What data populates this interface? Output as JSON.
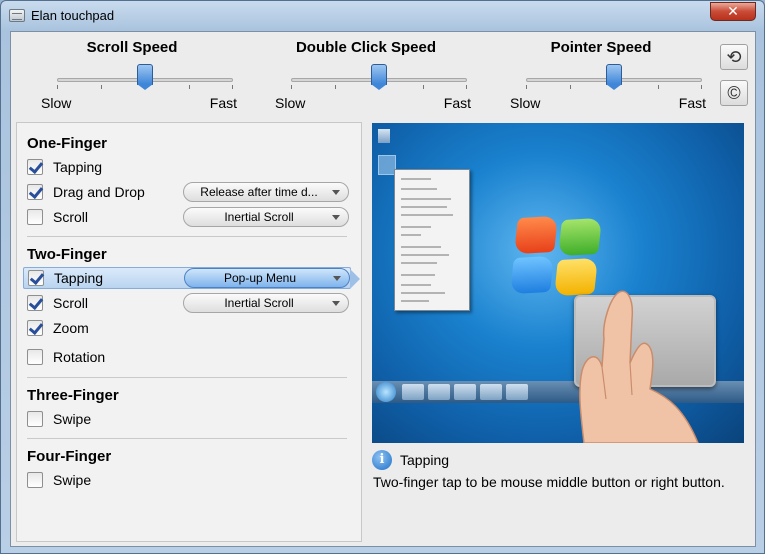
{
  "window": {
    "title": "Elan touchpad",
    "close_label": "✕"
  },
  "sliders": [
    {
      "title": "Scroll Speed",
      "min_label": "Slow",
      "max_label": "Fast",
      "value": 0.5
    },
    {
      "title": "Double Click Speed",
      "min_label": "Slow",
      "max_label": "Fast",
      "value": 0.5
    },
    {
      "title": "Pointer Speed",
      "min_label": "Slow",
      "max_label": "Fast",
      "value": 0.5
    }
  ],
  "side_buttons": {
    "reset_icon": "reset-icon",
    "about_icon": "copyright-icon",
    "reset_glyph": "⟲",
    "about_glyph": "©"
  },
  "groups": {
    "one_finger": {
      "title": "One-Finger",
      "tapping": {
        "label": "Tapping",
        "checked": true
      },
      "drag": {
        "label": "Drag and Drop",
        "checked": true,
        "option": "Release after time d..."
      },
      "scroll": {
        "label": "Scroll",
        "checked": false,
        "option": "Inertial Scroll"
      }
    },
    "two_finger": {
      "title": "Two-Finger",
      "tapping": {
        "label": "Tapping",
        "checked": true,
        "option": "Pop-up Menu"
      },
      "scroll": {
        "label": "Scroll",
        "checked": true,
        "option": "Inertial Scroll"
      },
      "zoom": {
        "label": "Zoom",
        "checked": true
      },
      "rotation": {
        "label": "Rotation",
        "checked": false
      }
    },
    "three_finger": {
      "title": "Three-Finger",
      "swipe": {
        "label": "Swipe",
        "checked": false
      }
    },
    "four_finger": {
      "title": "Four-Finger",
      "swipe": {
        "label": "Swipe",
        "checked": false
      }
    }
  },
  "info": {
    "title": "Tapping",
    "description": "Two-finger tap to be mouse middle button or right button.",
    "icon": "info-icon",
    "glyph": "i"
  },
  "colors": {
    "accent": "#3f86d9",
    "selected_row": "#b9d4f0"
  }
}
